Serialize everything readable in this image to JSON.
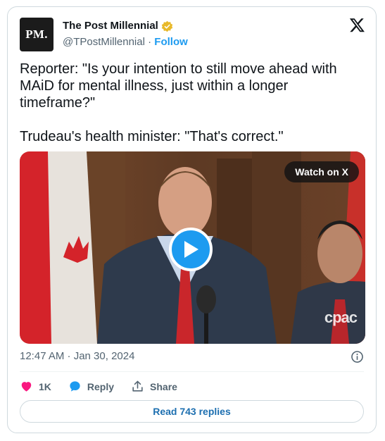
{
  "author": {
    "avatar_text": "PM.",
    "name": "The Post Millennial",
    "handle": "@TPostMillennial",
    "separator": "·",
    "follow_label": "Follow",
    "verified": "gold-verified-badge-icon"
  },
  "tweet": {
    "text": "Reporter: \"Is your intention to still move ahead with MAiD for mental illness, just within a longer timeframe?\"\n\nTrudeau's health minister: \"That's correct.\"",
    "timestamp": "12:47 AM · Jan 30, 2024"
  },
  "media": {
    "watch_label": "Watch on X",
    "watermark": "cpac",
    "play_icon": "play-icon"
  },
  "actions": {
    "likes": "1K",
    "reply_label": "Reply",
    "share_label": "Share"
  },
  "footer": {
    "read_replies": "Read 743 replies"
  },
  "colors": {
    "accent": "#1d9bf0",
    "like": "#f91880",
    "muted": "#536471",
    "verified": "#e8b92a"
  }
}
